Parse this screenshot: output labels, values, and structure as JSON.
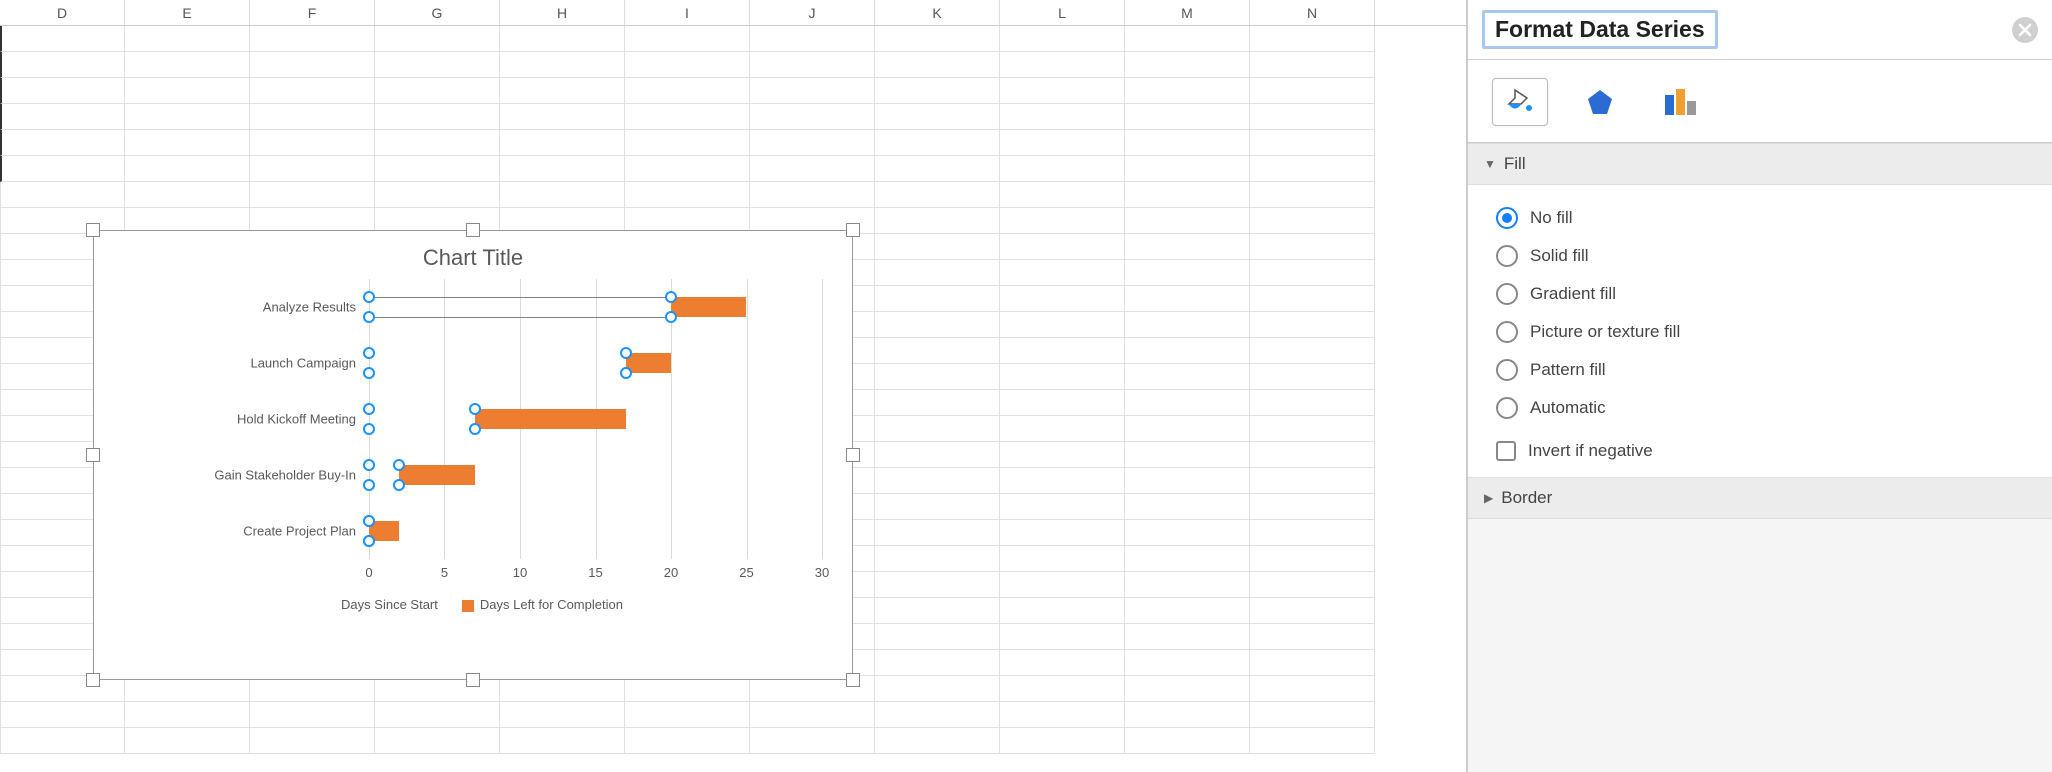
{
  "columns": [
    "D",
    "E",
    "F",
    "G",
    "H",
    "I",
    "J",
    "K",
    "L",
    "M",
    "N"
  ],
  "panel": {
    "title": "Format Data Series",
    "tabs": {
      "fill": "Fill & Line",
      "effects": "Effects",
      "series": "Series Options"
    },
    "fill_section": "Fill",
    "fill_options": {
      "no_fill": "No fill",
      "solid_fill": "Solid fill",
      "gradient_fill": "Gradient fill",
      "picture_fill": "Picture or texture fill",
      "pattern_fill": "Pattern fill",
      "automatic": "Automatic"
    },
    "invert": "Invert if negative",
    "border_section": "Border"
  },
  "chart_data": {
    "type": "bar",
    "title": "Chart Title",
    "xlabel": "",
    "ylabel": "",
    "xlim": [
      0,
      30
    ],
    "x_ticks": [
      0,
      5,
      10,
      15,
      20,
      25,
      30
    ],
    "categories": [
      "Analyze Results",
      "Launch Campaign",
      "Hold Kickoff Meeting",
      "Gain Stakeholder Buy-In",
      "Create Project Plan"
    ],
    "series": [
      {
        "name": "Days Since Start",
        "values": [
          20,
          17,
          7,
          2,
          0
        ],
        "color": "transparent",
        "selected": true
      },
      {
        "name": "Days Left for Completion",
        "values": [
          5,
          3,
          10,
          5,
          2
        ],
        "color": "#ed7d31"
      }
    ],
    "selection_line_top_offsets": [
      8,
      40
    ]
  }
}
